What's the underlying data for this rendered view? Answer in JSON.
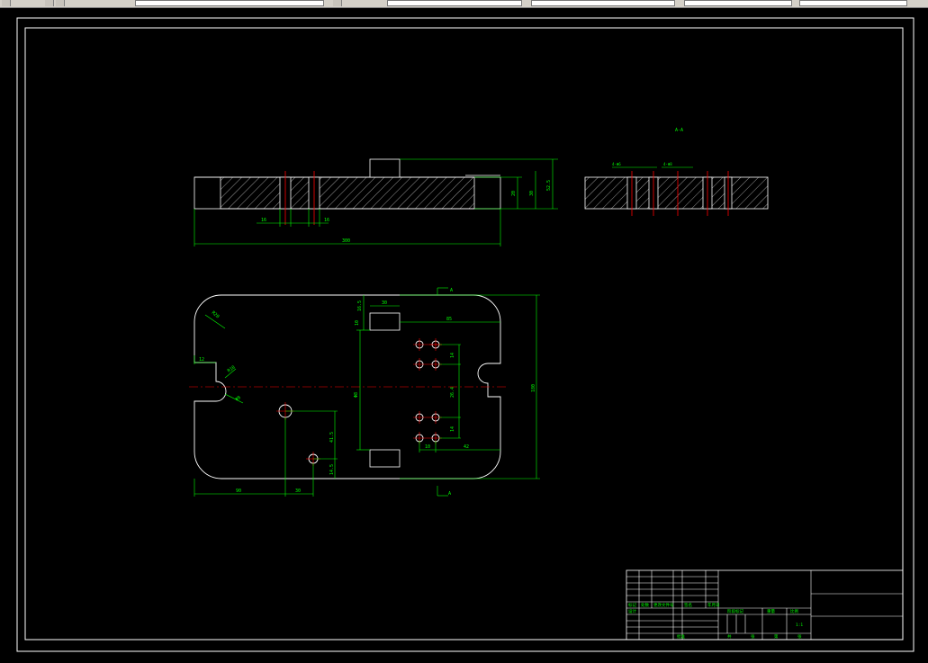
{
  "toolbar": {
    "fields": [
      "",
      "",
      "",
      "",
      ""
    ],
    "buttons": [
      "save-icon",
      "undo-icon",
      "redo-icon",
      "zoom-icon"
    ]
  },
  "drawing": {
    "section_label": "A-A",
    "colors": {
      "background": "#000000",
      "outline": "#ffffff",
      "dimension": "#00ff00",
      "centerline": "#ff0000"
    },
    "front_view": {
      "dims": {
        "d1": "16",
        "d2": "16",
        "overall": "300",
        "h1": "20",
        "h2": "30",
        "h3": "52.5"
      }
    },
    "section_view": {
      "callouts": {
        "c1": "4-Φ6",
        "c2": "4-Φ8"
      }
    },
    "plan_view": {
      "section_marker_top": "A",
      "section_marker_bottom": "A",
      "dims": {
        "radius": "R20",
        "slot_width": "12",
        "slot_r": "R10",
        "slot_d": "Φ8",
        "pocket_w": "30",
        "pocket_h1": "16.5",
        "pocket_h2": "10",
        "right_len": "85",
        "hole_pitch1": "14",
        "hole_pitch2": "26.4",
        "hole_pitch3": "14",
        "gap": "10",
        "offset": "42",
        "mid": "Φ8",
        "vert1": "41.5",
        "vert2": "14.5",
        "bottom1": "90",
        "bottom2": "30",
        "height": "180"
      }
    },
    "title_block": {
      "rev_labels": [
        "标记",
        "处数",
        "分区",
        "更改文件号",
        "签名",
        "年月日"
      ],
      "roles": [
        "设计",
        "审核",
        "工艺",
        "批准"
      ],
      "stage_labels": [
        "阶段标记",
        "重量",
        "比例"
      ],
      "scale": "1:1",
      "sheet": [
        "共",
        "张",
        "第",
        "张"
      ]
    }
  }
}
